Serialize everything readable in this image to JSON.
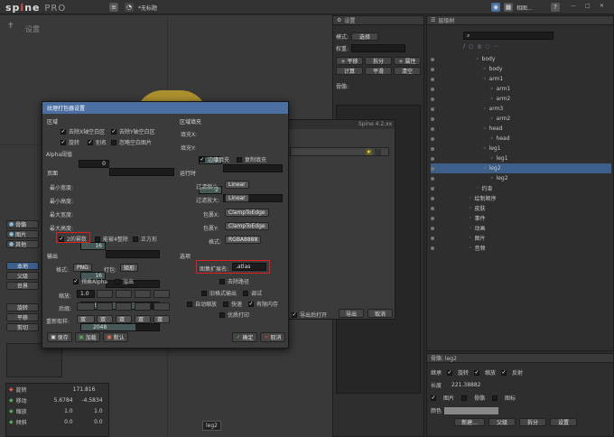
{
  "app": {
    "logo_main": "sp",
    "logo_mid": "ne",
    "logo_pro": "PRO",
    "doc_title": "*无标题",
    "win_btn": "相图..."
  },
  "viewport": {
    "mode_label": "设置",
    "bone_label": "leg2"
  },
  "left_tools": {
    "pose": [
      "骨骼",
      "图片",
      "其他"
    ],
    "transform": [
      "本地",
      "父级",
      "世界"
    ],
    "compensate": [
      "旋转",
      "平移",
      "剪切"
    ],
    "values": {
      "rotate_label": "旋转",
      "rotate_val": "171.816",
      "translate_label": "移动",
      "translate_x": "5.6784",
      "translate_y": "-4.5834",
      "scale_label": "缩放",
      "scale_x": "1.0",
      "scale_y": "1.0",
      "shear_label": "倾斜",
      "shear_x": "0.0",
      "shear_y": "0.0"
    }
  },
  "settings_panel": {
    "title": "设置",
    "mode_label": "模式:",
    "mode_value": "选择",
    "weight_label": "权重:",
    "buttons": [
      "+ 平移",
      "拆分",
      "+ 属性",
      "计算",
      "平滑",
      "清空"
    ],
    "meta_label": "骨骼:"
  },
  "hierarchy": {
    "title": "层级树",
    "search_placeholder": "",
    "items": [
      "body",
      "body",
      "arm1",
      "arm1",
      "arm2",
      "arm3",
      "arm2",
      "head",
      "head",
      "leg1",
      "leg1",
      "leg2",
      "leg2",
      "约束",
      "绘制顺序",
      "皮肤",
      "事件",
      "动画",
      "图片",
      "音频"
    ]
  },
  "bone_props": {
    "title": "骨骼: leg2",
    "tabs": [
      "继承",
      "旋转",
      "缩放",
      "反射"
    ],
    "length_label": "长度",
    "length_val": "221.38882",
    "flag_labels": [
      "图片",
      "骨骼",
      "图标"
    ],
    "color_label": "颜色",
    "actions": [
      "新建...",
      "父级",
      "拆分",
      "设置"
    ]
  },
  "spine_window": {
    "title": "Spine 4.2.xx",
    "export_open": "导出后打开",
    "export_btn": "导出",
    "cancel_btn": "取消"
  },
  "dialog": {
    "title": "纹理打包器设置",
    "region": {
      "head": "区域",
      "strip_x": "去除X轴空白区",
      "strip_y": "去除Y轴空白区",
      "rotate": "旋转",
      "alias": "别名",
      "ignore_blank": "忽略空白图片",
      "alpha_label": "Alpha阈值",
      "alpha_val": "0"
    },
    "pad": {
      "head": "区域填充",
      "pad_x_label": "填充X:",
      "pad_x": "2",
      "pad_y_label": "填充Y:",
      "pad_y": "2",
      "edge_pad": "边缘填充",
      "dup_pad": "复制填充"
    },
    "pages": {
      "head": "页面",
      "min_w_label": "最小宽度:",
      "min_w": "16",
      "min_h_label": "最小高度:",
      "min_h": "16",
      "max_w_label": "最大宽度:",
      "max_w": "2048",
      "max_h_label": "最大高度:",
      "max_h": "2048",
      "pot": "2的幂数",
      "mult4": "能被4整除",
      "square": "正方形"
    },
    "runtime": {
      "head": "运行时",
      "min_filter_label": "过滤缩小:",
      "min_filter": "Linear",
      "mag_filter_label": "过滤放大:",
      "mag_filter": "Linear",
      "wrap_x_label": "包裹X:",
      "wrap_x": "ClampToEdge",
      "wrap_y_label": "包裹Y:",
      "wrap_y": "ClampToEdge",
      "format_label": "格式:",
      "format": "RGBA8888"
    },
    "output": {
      "head": "输出",
      "format_label": "格式:",
      "format": "PNG",
      "pack_label": "打包:",
      "pack": "矩形",
      "premultiply": "预乘Alpha",
      "bleed": "溢出",
      "scale_label": "缩放:",
      "scale_val": "1.0",
      "suffix_label": "后缀:",
      "resample_label": "重新取样:",
      "resample": [
        "双",
        "双",
        "双",
        "双",
        "双"
      ]
    },
    "options": {
      "head": "选项",
      "atlas_ext_label": "图集扩展名:",
      "atlas_ext": ".atlas",
      "strip_path": "去除路径",
      "legacy_output": "旧格式输出",
      "debug": "调试",
      "auto_scale": "自动缩放",
      "fast": "快速",
      "limit_memory": "有限内存",
      "pretty_print": "优质打印"
    },
    "footer": {
      "save": "保存",
      "load": "加载",
      "default": "默认",
      "ok": "确定",
      "cancel": "取消"
    }
  }
}
